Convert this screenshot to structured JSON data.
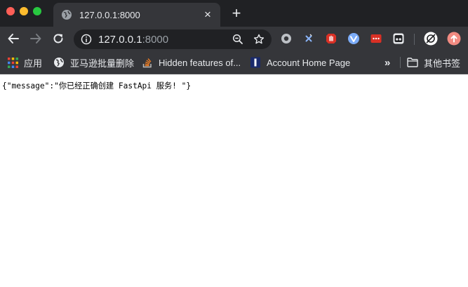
{
  "tab": {
    "title": "127.0.0.1:8000",
    "close_glyph": "×"
  },
  "new_tab_glyph": "+",
  "omnibox": {
    "host": "127.0.0.1",
    "port": ":8000"
  },
  "bookmarks": {
    "apps": "应用",
    "item1": "亚马逊批量删除",
    "item2": "Hidden features of...",
    "item3": "Account Home Page",
    "overflow": "»",
    "other": "其他书签"
  },
  "page": {
    "body": "{\"message\":\"你已经正确创建 FastApi 服务! \"}"
  },
  "colors": {
    "chrome_dark": "#202124",
    "toolbar": "#35363a",
    "text": "#e8eaed"
  }
}
